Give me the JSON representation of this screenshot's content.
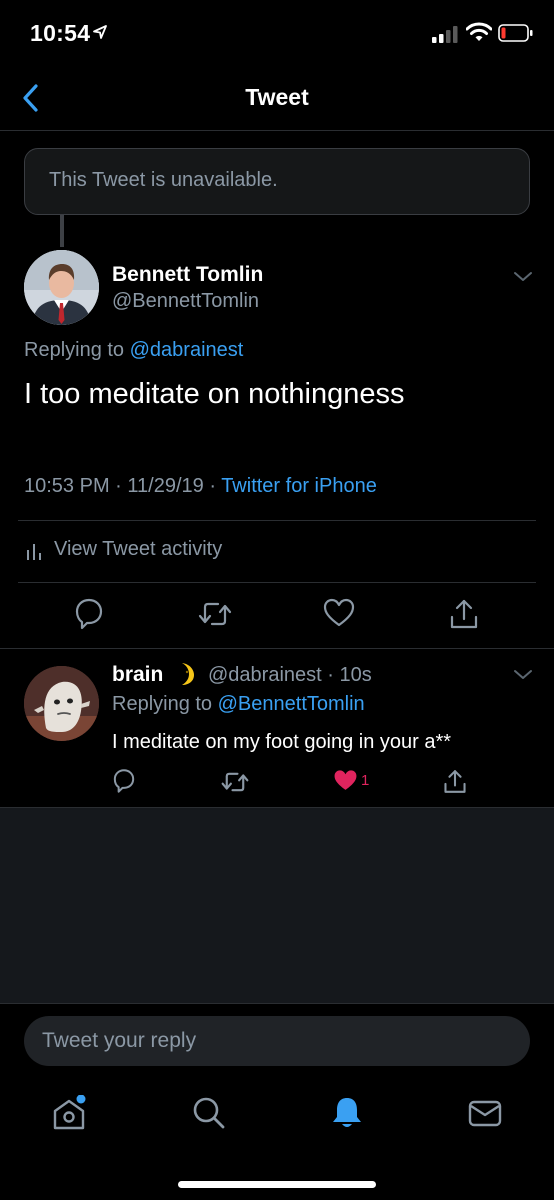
{
  "status_bar": {
    "time": "10:54"
  },
  "nav": {
    "title": "Tweet"
  },
  "quoted": {
    "unavailable_text": "This Tweet is unavailable."
  },
  "main_tweet": {
    "author_name": "Bennett Tomlin",
    "author_handle": "@BennettTomlin",
    "replying_prefix": "Replying to ",
    "replying_to": "@dabrainest",
    "text": "I too meditate on nothingness",
    "time": "10:53 PM",
    "date": "11/29/19",
    "source": "Twitter for iPhone",
    "activity_label": "View Tweet activity"
  },
  "reply": {
    "author_name": "brain",
    "author_handle": "@dabrainest",
    "age": "10s",
    "replying_prefix": "Replying to ",
    "replying_to": "@BennettTomlin",
    "text": "I meditate on my foot going in your a**",
    "like_count": "1"
  },
  "compose": {
    "placeholder": "Tweet your reply"
  },
  "colors": {
    "accent": "#3aa0f2",
    "like": "#e0245e",
    "muted": "#8b98a5",
    "background": "#000000",
    "panel": "#15181c"
  },
  "icons": {
    "back": "chevron-left-icon",
    "reply": "speech-bubble-icon",
    "retweet": "retweet-icon",
    "like": "heart-icon",
    "share": "share-icon",
    "home": "home-icon",
    "search": "search-icon",
    "notifications": "bell-icon",
    "messages": "envelope-icon"
  }
}
